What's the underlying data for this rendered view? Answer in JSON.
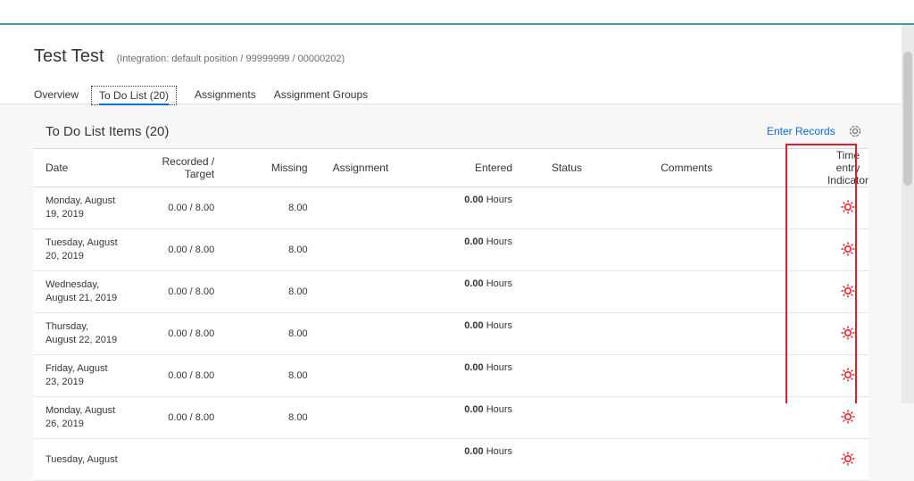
{
  "header": {
    "title": "Test Test",
    "subtitle": "(Integration: default position / 99999999 / 00000202)",
    "tabs": [
      {
        "label": "Overview"
      },
      {
        "label": "To Do List (20)"
      },
      {
        "label": "Assignments"
      },
      {
        "label": "Assignment Groups"
      }
    ]
  },
  "panel": {
    "title": "To Do List Items (20)",
    "enter_records": "Enter Records",
    "icons": {
      "settings": "gear-icon",
      "indicator": "sun-icon"
    },
    "columns": {
      "date": "Date",
      "recorded": "Recorded / Target",
      "missing": "Missing",
      "assignment": "Assignment",
      "entered": "Entered",
      "status": "Status",
      "comments": "Comments",
      "indicator_line1": "Time entry",
      "indicator_line2": "Indicator"
    },
    "rows": [
      {
        "date1": "Monday, August",
        "date2": "19, 2019",
        "recorded": "0.00 / 8.00",
        "missing": "8.00",
        "entered_value": "0.00",
        "entered_unit": "Hours"
      },
      {
        "date1": "Tuesday, August",
        "date2": "20, 2019",
        "recorded": "0.00 / 8.00",
        "missing": "8.00",
        "entered_value": "0.00",
        "entered_unit": "Hours"
      },
      {
        "date1": "Wednesday,",
        "date2": "August 21, 2019",
        "recorded": "0.00 / 8.00",
        "missing": "8.00",
        "entered_value": "0.00",
        "entered_unit": "Hours"
      },
      {
        "date1": "Thursday,",
        "date2": "August 22, 2019",
        "recorded": "0.00 / 8.00",
        "missing": "8.00",
        "entered_value": "0.00",
        "entered_unit": "Hours"
      },
      {
        "date1": "Friday, August",
        "date2": "23, 2019",
        "recorded": "0.00 / 8.00",
        "missing": "8.00",
        "entered_value": "0.00",
        "entered_unit": "Hours"
      },
      {
        "date1": "Monday, August",
        "date2": "26, 2019",
        "recorded": "0.00 / 8.00",
        "missing": "8.00",
        "entered_value": "0.00",
        "entered_unit": "Hours"
      },
      {
        "date1": "Tuesday, August",
        "date2": "",
        "recorded": "",
        "missing": "",
        "entered_value": "0.00",
        "entered_unit": "Hours"
      }
    ]
  },
  "colors": {
    "accent": "#0a6ed1",
    "topbar_border": "#3a9ba6",
    "indicator": "#e8222e",
    "highlight": "#d9212c"
  }
}
